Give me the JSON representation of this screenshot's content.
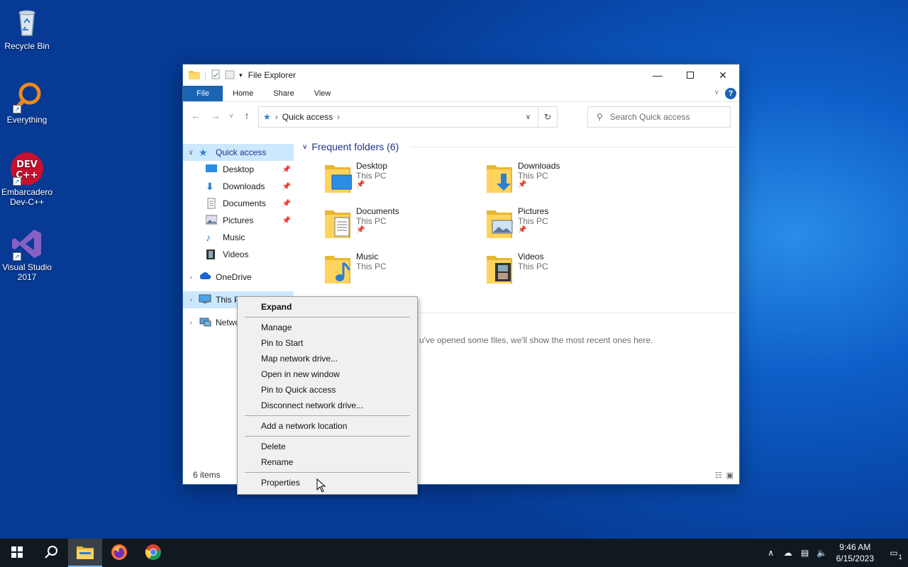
{
  "desktop": {
    "icons": [
      {
        "label_line1": "Recycle Bin",
        "label_line2": ""
      },
      {
        "label_line1": "Everything",
        "label_line2": ""
      },
      {
        "label_line1": "Embarcadero",
        "label_line2": "Dev-C++"
      },
      {
        "label_line1": "Visual Studio",
        "label_line2": "2017"
      }
    ]
  },
  "window": {
    "title": "File Explorer",
    "ribbon_tabs": [
      "File",
      "Home",
      "Share",
      "View"
    ],
    "help_label": "?",
    "breadcrumb": "Quick access",
    "search_placeholder": "Search Quick access",
    "nav": {
      "quick_access": "Quick access",
      "items": [
        "Desktop",
        "Downloads",
        "Documents",
        "Pictures",
        "Music",
        "Videos"
      ],
      "onedrive": "OneDrive",
      "this_pc": "This P",
      "network": "Netwo"
    },
    "frequent_header": "Frequent folders (6)",
    "folders": [
      {
        "name": "Desktop",
        "location": "This PC",
        "pinned": true
      },
      {
        "name": "Downloads",
        "location": "This PC",
        "pinned": true
      },
      {
        "name": "Documents",
        "location": "This PC",
        "pinned": true
      },
      {
        "name": "Pictures",
        "location": "This PC",
        "pinned": true
      },
      {
        "name": "Music",
        "location": "This PC",
        "pinned": false
      },
      {
        "name": "Videos",
        "location": "This PC",
        "pinned": false
      }
    ],
    "recent_message": "u've opened some files, we'll show the most recent ones here.",
    "status_items": "6 items"
  },
  "context_menu": {
    "expand": "Expand",
    "manage": "Manage",
    "pin_to_start": "Pin to Start",
    "map_network_drive": "Map network drive...",
    "open_new_window": "Open in new window",
    "pin_quick_access": "Pin to Quick access",
    "disconnect_network_drive": "Disconnect network drive...",
    "add_network_location": "Add a network location",
    "delete": "Delete",
    "rename": "Rename",
    "properties": "Properties"
  },
  "taskbar": {
    "time": "9:46 AM",
    "date": "6/15/2023",
    "notification_count": "1"
  },
  "colors": {
    "accent": "#1a64b4",
    "selection": "#cce8ff",
    "taskbar": "#101820"
  }
}
